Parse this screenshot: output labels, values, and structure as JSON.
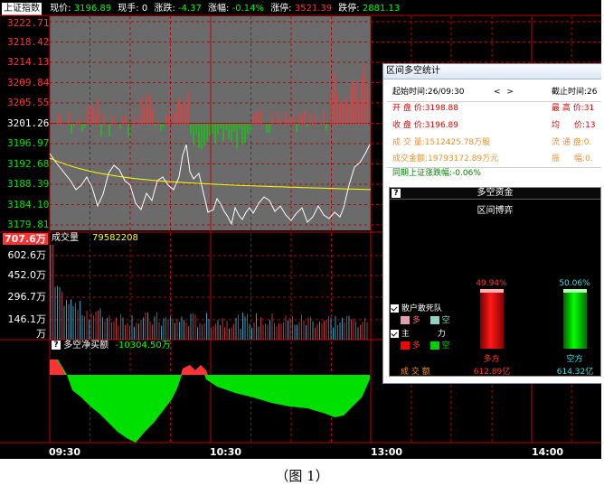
{
  "header": {
    "index_name": "上证指数",
    "price_label": "现价:",
    "price_value": "3196.89",
    "vol_label": "现手:",
    "vol_value": "0",
    "change_label": "涨跌:",
    "change_value": "-4.37",
    "pct_label": "涨幅:",
    "pct_value": "-0.14%",
    "limit_up_label": "涨停:",
    "limit_up_value": "3521.39",
    "limit_down_label": "跌停:",
    "limit_down_value": "2881.13"
  },
  "price_axis": {
    "labels": [
      "3222.71",
      "3218.42",
      "3214.13",
      "3209.84",
      "3205.55",
      "3201.26",
      "3196.97",
      "3192.68",
      "3188.39",
      "3184.10",
      "3179.81"
    ]
  },
  "volume_panel": {
    "max_label": "707.6万",
    "title": "成交量",
    "value": "79582208",
    "axis_labels": [
      "602.6万",
      "452.0万",
      "296.7万",
      "146.1万",
      "万"
    ]
  },
  "net_panel": {
    "icon": "?",
    "title": "多空净买额",
    "value": "-10304.50万"
  },
  "x_axis": {
    "ticks": [
      "09:30",
      "10:30",
      "13:00",
      "14:00"
    ]
  },
  "popup": {
    "title": "区间多空统计",
    "start_label": "起始时间:",
    "start_value": "26/09:30",
    "nav_prev": "<",
    "nav_next": ">",
    "end_label": "截止时间:",
    "end_value": "26",
    "open_label": "开 盘 价:",
    "open_value": "3198.88",
    "high_label": "最 高 价:",
    "high_value": "31",
    "close_label": "收 盘 价:",
    "close_value": "3196.89",
    "avg_label": "均",
    "avg_mid": "价:",
    "avg_value": "13",
    "vol_label": "成 交 量:",
    "vol_value": "1512425.78万股",
    "float_label": "流 通 盘:",
    "float_value": "0.",
    "amount_label": "成交金额:",
    "amount_value": "19793172.89万元",
    "swing_label": "振",
    "swing_mid": "幅:",
    "swing_value": "0.",
    "same_period": "同期上证涨跌幅:-0.06%"
  },
  "duokong": {
    "title": "多空资金",
    "subtitle": "区间博弈",
    "legend_retail": "散户敢死队",
    "legend_retail_long": "多",
    "legend_retail_short": "空",
    "legend_main_a": "主",
    "legend_main_b": "力",
    "legend_main_long": "多",
    "legend_main_short": "空",
    "amount_label": "成  交  额",
    "long_pct": "49.94%",
    "short_pct": "50.06%",
    "long_name": "多方",
    "short_name": "空方",
    "long_amount": "612.89亿",
    "short_amount": "614.32亿"
  },
  "colors": {
    "up": "#ff3333",
    "down": "#00e000",
    "price_line": "#ffffff",
    "avg_line": "#ffff00",
    "chart_bg": "#6b6b6b"
  },
  "caption": "（图 1）"
}
